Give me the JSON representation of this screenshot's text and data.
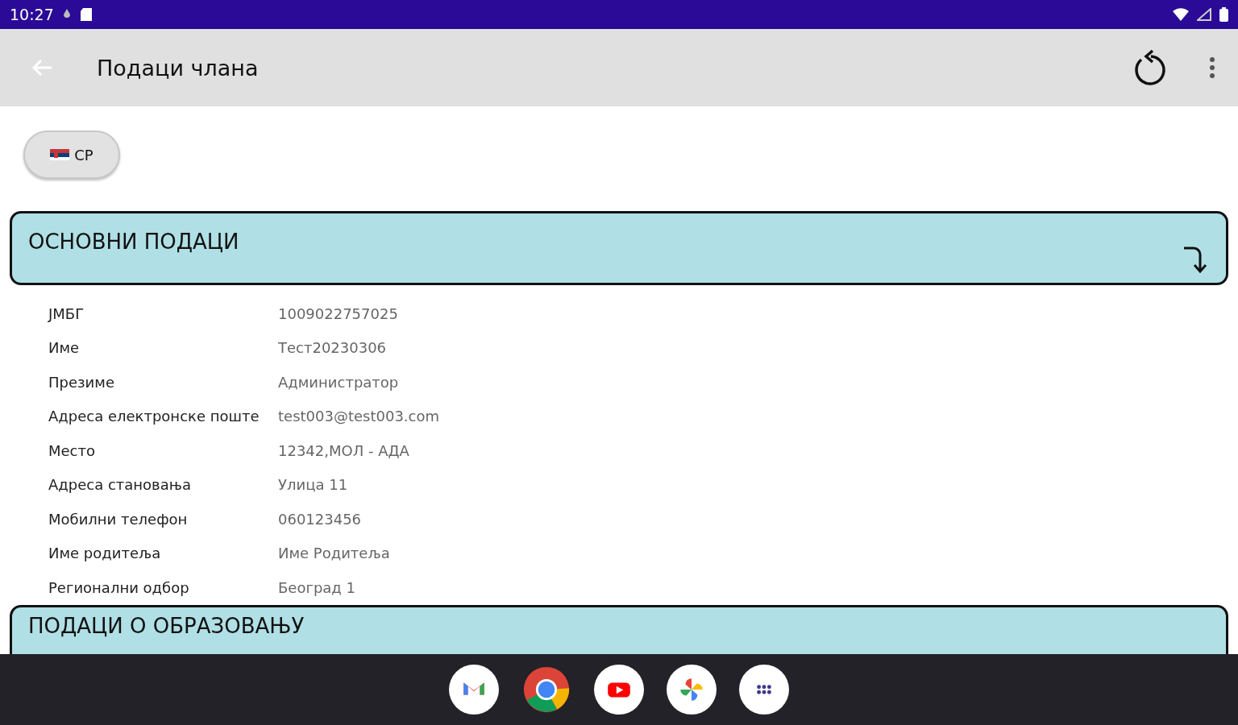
{
  "status_bar": {
    "time": "10:27"
  },
  "app_bar": {
    "title": "Подаци члана"
  },
  "language_button": {
    "label": "СР"
  },
  "sections": [
    {
      "title": "ОСНОВНИ ПОДАЦИ",
      "expanded": true,
      "fields": [
        {
          "label": "ЈМБГ",
          "value": "1009022757025"
        },
        {
          "label": "Име",
          "value": "Тест20230306"
        },
        {
          "label": "Презиме",
          "value": "Администратор"
        },
        {
          "label": "Адреса електронске поште",
          "value": "test003@test003.com"
        },
        {
          "label": "Место",
          "value": "12342,МОЛ - АДА"
        },
        {
          "label": "Адреса становања",
          "value": "Улица 11"
        },
        {
          "label": "Мобилни телефон",
          "value": "060123456"
        },
        {
          "label": "Име родитеља",
          "value": "Име Родитеља"
        },
        {
          "label": "Регионални одбор",
          "value": "Београд 1"
        }
      ]
    },
    {
      "title": "ПОДАЦИ О ОБРАЗОВАЊУ",
      "expanded": false
    }
  ],
  "dock": [
    {
      "kind": "mail"
    },
    {
      "kind": "browser"
    },
    {
      "kind": "video"
    },
    {
      "kind": "photos"
    },
    {
      "kind": "apps"
    }
  ]
}
